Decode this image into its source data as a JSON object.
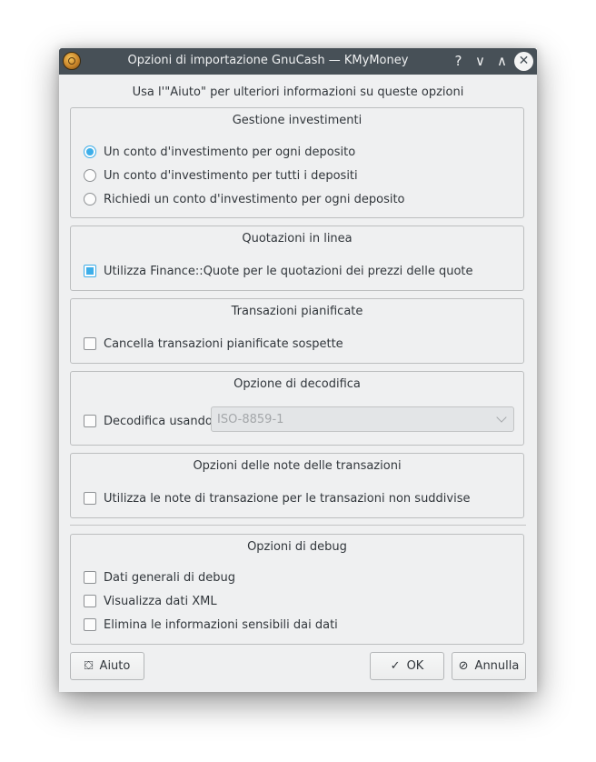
{
  "window": {
    "title": "Opzioni di importazione GnuCash — KMyMoney",
    "help_glyph": "?",
    "minimize_glyph": "∨",
    "maximize_glyph": "∧",
    "close_glyph": "✕"
  },
  "hint": "Usa l'\"Aiuto\" per ulteriori informazioni su queste opzioni",
  "investments": {
    "title": "Gestione investimenti",
    "options": [
      {
        "label": "Un conto d'investimento per ogni deposito",
        "checked": true
      },
      {
        "label": "Un conto d'investimento per tutti i depositi",
        "checked": false
      },
      {
        "label": "Richiedi un conto d'investimento per ogni deposito",
        "checked": false
      }
    ]
  },
  "quotes": {
    "title": "Quotazioni in linea",
    "option": {
      "label": "Utilizza Finance::Quote per le quotazioni dei prezzi delle quote",
      "checked": true
    }
  },
  "scheduled": {
    "title": "Transazioni pianificate",
    "option": {
      "label": "Cancella transazioni pianificate sospette",
      "checked": false
    }
  },
  "decoding": {
    "title": "Opzione di decodifica",
    "option": {
      "label": "Decodifica usando",
      "checked": false
    },
    "encoding_value": "ISO-8859-1"
  },
  "notes": {
    "title": "Opzioni delle note delle transazioni",
    "option": {
      "label": "Utilizza le note di transazione per le transazioni non suddivise",
      "checked": false
    }
  },
  "debug": {
    "title": "Opzioni di debug",
    "options": [
      {
        "label": "Dati generali di debug",
        "checked": false
      },
      {
        "label": "Visualizza dati XML",
        "checked": false
      },
      {
        "label": "Elimina le informazioni sensibili dai dati",
        "checked": false
      }
    ]
  },
  "buttons": {
    "help": {
      "label": "Aiuto",
      "icon": "lifebuoy-icon",
      "glyph": "⛋"
    },
    "ok": {
      "label": "OK",
      "icon": "checkmark-icon",
      "glyph": "✓"
    },
    "cancel": {
      "label": "Annulla",
      "icon": "cancel-icon",
      "glyph": "⊘"
    }
  },
  "colors": {
    "titlebar": "#475057",
    "window_bg": "#eff0f1",
    "accent": "#3daee9"
  }
}
